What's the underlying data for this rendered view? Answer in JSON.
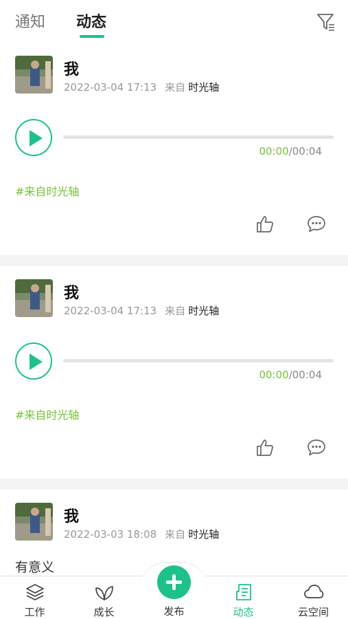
{
  "tabs": {
    "notify": "通知",
    "feed": "动态"
  },
  "icons": {
    "filter": "filter-icon",
    "play": "play-icon",
    "like": "thumbs-up-icon",
    "comment": "comment-icon",
    "work": "layers-icon",
    "growth": "leaf-icon",
    "publish": "plus-icon",
    "feed": "document-icon",
    "cloud": "cloud-icon"
  },
  "colors": {
    "accent": "#1cc28a",
    "tag": "#77c33a",
    "muted": "#999999"
  },
  "posts": [
    {
      "author": "我",
      "datetime": "2022-03-04 17:13",
      "source_label": "来自",
      "source_name": "时光轴",
      "audio": {
        "current": "00:00",
        "sep": "/",
        "duration": "00:04",
        "progress": 0
      },
      "tag": "#来自时光轴"
    },
    {
      "author": "我",
      "datetime": "2022-03-04 17:13",
      "source_label": "来自",
      "source_name": "时光轴",
      "audio": {
        "current": "00:00",
        "sep": "/",
        "duration": "00:04",
        "progress": 0
      },
      "tag": "#来自时光轴"
    },
    {
      "author": "我",
      "datetime": "2022-03-03 18:08",
      "source_label": "来自",
      "source_name": "时光轴",
      "text": "有意义"
    }
  ],
  "bottom_nav": {
    "work": "工作",
    "growth": "成长",
    "publish": "发布",
    "feed": "动态",
    "cloud": "云空间"
  },
  "active_nav": "动态"
}
